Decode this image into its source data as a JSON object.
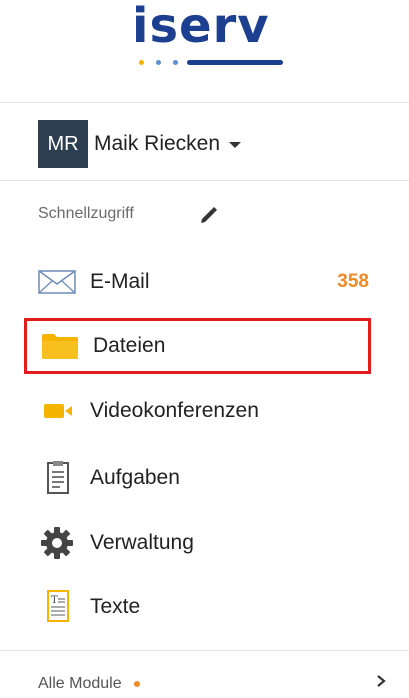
{
  "logo": {
    "text": "iserv",
    "colors": {
      "primary": "#1d3f8f",
      "dot_yellow": "#f5b400",
      "dot_blue": "#5b8fd6"
    }
  },
  "user": {
    "initials": "MR",
    "name": "Maik Riecken"
  },
  "quick_access": {
    "label": "Schnellzugriff"
  },
  "menu": [
    {
      "id": "email",
      "label": "E-Mail",
      "badge": "358",
      "icon": "mail-icon"
    },
    {
      "id": "dateien",
      "label": "Dateien",
      "icon": "folder-icon",
      "highlighted": true
    },
    {
      "id": "videokonferenzen",
      "label": "Videokonferenzen",
      "icon": "video-camera-icon"
    },
    {
      "id": "aufgaben",
      "label": "Aufgaben",
      "icon": "clipboard-icon"
    },
    {
      "id": "verwaltung",
      "label": "Verwaltung",
      "icon": "gear-icon"
    },
    {
      "id": "texte",
      "label": "Texte",
      "icon": "text-document-icon"
    }
  ],
  "footer": {
    "all_modules_label": "Alle Module"
  },
  "colors": {
    "accent": "#f08a24",
    "highlight_border": "#e21b1b",
    "avatar_bg": "#2d3e50",
    "folder": "#f5b400"
  }
}
